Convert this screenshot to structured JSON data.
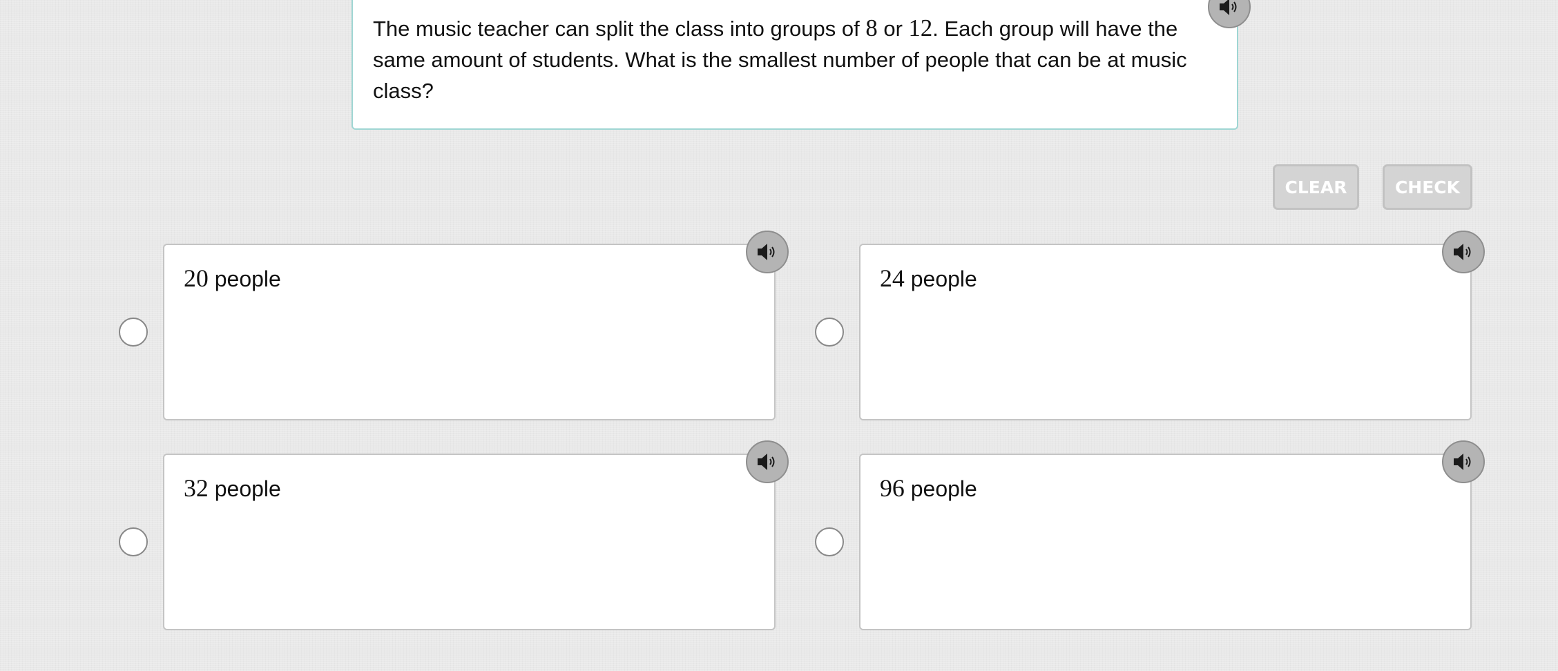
{
  "question": {
    "text_before": "The music teacher can split the class into groups of ",
    "num1": "8",
    "text_middle": " or ",
    "num2": "12",
    "text_after": ". Each group will have the same amount of students. What is the smallest number of people that can be at music class?",
    "speaker_icon": "speaker-icon"
  },
  "actions": {
    "clear_label": "CLEAR",
    "check_label": "CHECK"
  },
  "options": [
    {
      "value": "20",
      "label": " people",
      "speaker_icon": "speaker-icon",
      "selected": false
    },
    {
      "value": "24",
      "label": " people",
      "speaker_icon": "speaker-icon",
      "selected": false
    },
    {
      "value": "32",
      "label": " people",
      "speaker_icon": "speaker-icon",
      "selected": false
    },
    {
      "value": "96",
      "label": " people",
      "speaker_icon": "speaker-icon",
      "selected": false
    }
  ],
  "colors": {
    "background": "#e9e9e9",
    "question_border": "#9fd6d3",
    "button_disabled_bg": "#d4d4d4",
    "button_text": "#ffffff",
    "speaker_bg": "#b4b4b4"
  }
}
